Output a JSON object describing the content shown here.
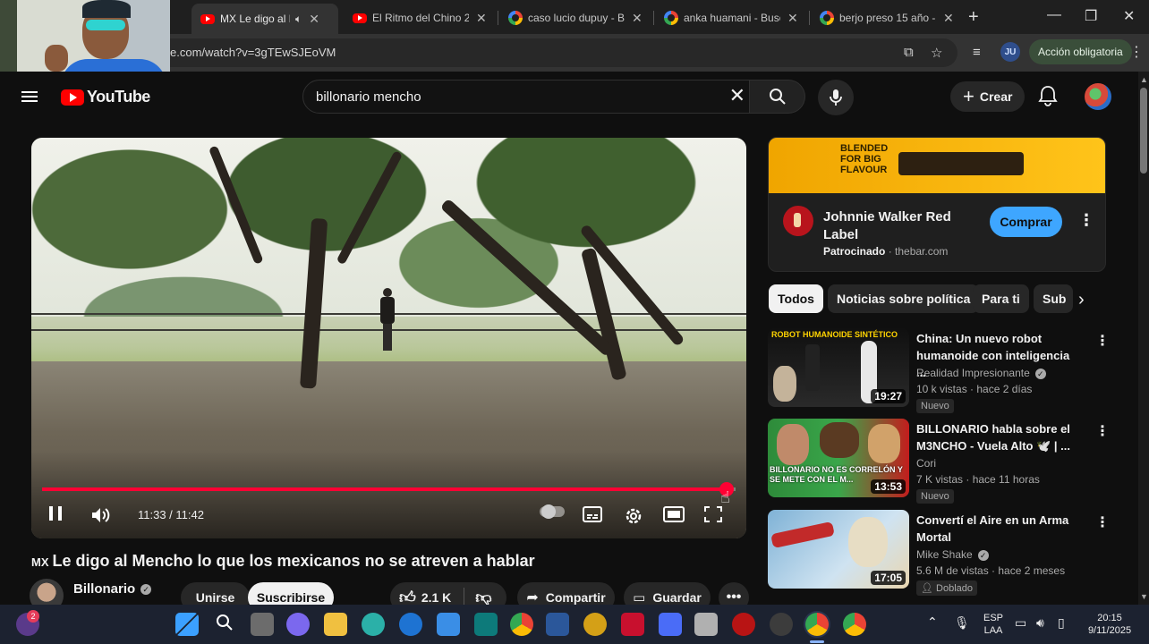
{
  "browser": {
    "tabs": [
      {
        "title": "MX Le digo al Me",
        "active": true,
        "favicon": "youtube",
        "audio": true
      },
      {
        "title": "El Ritmo del Chino 20",
        "active": false,
        "favicon": "youtube"
      },
      {
        "title": "caso lucio dupuy - Bu",
        "active": false,
        "favicon": "google"
      },
      {
        "title": "anka huamani - Busca",
        "active": false,
        "favicon": "google"
      },
      {
        "title": "berjo preso 15 año -",
        "active": false,
        "favicon": "google"
      }
    ],
    "url": "e.com/watch?v=3gTEwSJEoVM",
    "account_initials": "JU",
    "action_button": "Acción obligatoria"
  },
  "youtube": {
    "logo_text": "YouTube",
    "search_query": "billonario mencho",
    "create_label": "Crear"
  },
  "player": {
    "time_display": "11:33 / 11:42",
    "progress_fraction": 0.987,
    "state": "playing"
  },
  "video": {
    "country_tag": "MX",
    "title": "Le digo al Mencho lo que los mexicanos no se atreven a hablar",
    "channel": "Billonario",
    "join_label": "Unirse",
    "subscribe_label": "Suscribirse",
    "likes": "2.1 K",
    "share_label": "Compartir",
    "save_label": "Guardar"
  },
  "ad": {
    "banner_text": "BLENDED FOR BIG FLAVOUR",
    "title": "Johnnie Walker Red Label",
    "sponsored": "Patrocinado",
    "domain": "thebar.com",
    "cta": "Comprar"
  },
  "chips": [
    "Todos",
    "Noticias sobre política",
    "Para ti",
    "Sub"
  ],
  "related": [
    {
      "title": "China: Un nuevo robot humanoide con inteligencia ...",
      "thumb_text": "ROBOT HUMANOIDE SINTÉTICO",
      "channel": "Realidad Impresionante",
      "verified": true,
      "views": "10 k vistas",
      "age": "hace 2 días",
      "badge": "Nuevo",
      "duration": "19:27"
    },
    {
      "title": "BILLONARIO habla sobre el M3NCHO - Vuela Alto 🕊️ | ...",
      "thumb_text": "BILLONARIO NO ES CORRELÓN Y SE METE CON EL M...",
      "channel": "Cori",
      "verified": false,
      "views": "7 K vistas",
      "age": "hace 11 horas",
      "badge": "Nuevo",
      "duration": "13:53"
    },
    {
      "title": "Convertí el Aire en un Arma Mortal",
      "thumb_text": "",
      "channel": "Mike Shake",
      "verified": true,
      "views": "5.6 M de vistas",
      "age": "hace 2 meses",
      "badge": "Doblado",
      "duration": "17:05"
    }
  ],
  "taskbar": {
    "lang_line1": "ESP",
    "lang_line2": "LAA",
    "time": "20:15",
    "date": "9/11/2025",
    "notification_count": "2"
  },
  "colors": {
    "yt_red": "#ff0000",
    "progress_red": "#ff0033",
    "cta_blue": "#3ea6ff",
    "background": "#0f0f0f"
  }
}
